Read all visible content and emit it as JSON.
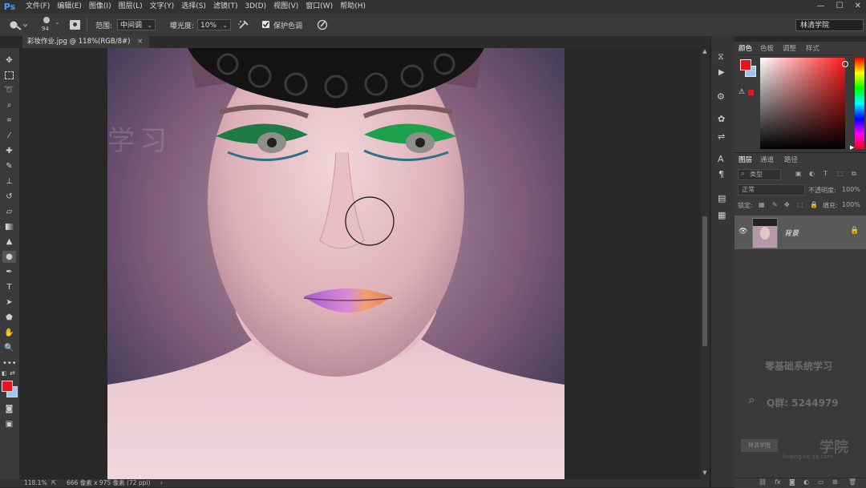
{
  "app": {
    "logo": "Ps"
  },
  "menu": [
    "文件(F)",
    "编辑(E)",
    "图像(I)",
    "图层(L)",
    "文字(Y)",
    "选择(S)",
    "滤镜(T)",
    "3D(D)",
    "视图(V)",
    "窗口(W)",
    "帮助(H)"
  ],
  "window_controls": {
    "minimize": "—",
    "maximize": "☐",
    "close": "✕"
  },
  "options": {
    "brush_size": "94",
    "range_label": "范围:",
    "range_value": "中间调",
    "exposure_label": "曝光度:",
    "exposure_value": "10%",
    "protect_tones_label": "保护色调",
    "protect_tones_checked": true,
    "workspace": "林清学院"
  },
  "document_tab": {
    "title": "彩妆作业.jpg @ 118%(RGB/8#)",
    "close": "×"
  },
  "status": {
    "zoom": "118.1%",
    "size": "666 像素 x 975 像素 (72 ppi)"
  },
  "color_panel": {
    "tabs": [
      "颜色",
      "色板",
      "调整",
      "样式"
    ],
    "foreground": "#e8141a",
    "background": "#9ec3ee"
  },
  "layers_panel": {
    "tabs": [
      "图层",
      "通道",
      "路径"
    ],
    "filter_label": "类型",
    "blend_mode": "正常",
    "opacity_label": "不透明度:",
    "opacity_value": "100%",
    "lock_label": "锁定:",
    "fill_label": "填充:",
    "fill_value": "100%",
    "layer_name": "背景"
  },
  "watermark": {
    "line1": "零基础系统学习",
    "qq": "Q群: 5244979",
    "academy": "学院",
    "logo_text": "林清学院",
    "url": "linqing.ke.qq.com"
  },
  "canvas_watermark": "学习"
}
